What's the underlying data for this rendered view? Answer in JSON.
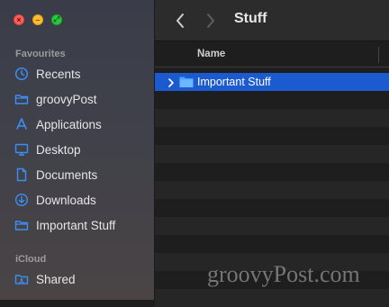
{
  "window": {
    "title": "Stuff"
  },
  "traffic_lights": [
    "close",
    "minimize",
    "zoom"
  ],
  "sidebar": {
    "sections": [
      {
        "label": "Favourites",
        "items": [
          {
            "label": "Recents",
            "icon": "clock-icon"
          },
          {
            "label": "groovyPost",
            "icon": "folder-icon"
          },
          {
            "label": "Applications",
            "icon": "applications-icon"
          },
          {
            "label": "Desktop",
            "icon": "desktop-icon"
          },
          {
            "label": "Documents",
            "icon": "document-icon"
          },
          {
            "label": "Downloads",
            "icon": "download-icon"
          },
          {
            "label": "Important Stuff",
            "icon": "folder-icon"
          }
        ]
      },
      {
        "label": "iCloud",
        "items": [
          {
            "label": "Shared",
            "icon": "shared-folder-icon"
          }
        ]
      }
    ]
  },
  "list": {
    "column_header": "Name",
    "rows": [
      {
        "name": "Important Stuff",
        "kind": "folder",
        "selected": true
      }
    ]
  },
  "watermark": "groovyPost.com",
  "colors": {
    "accent": "#1c5ad0",
    "sidebar_icon": "#3b8ff6",
    "folder": "#4aa3ff"
  }
}
